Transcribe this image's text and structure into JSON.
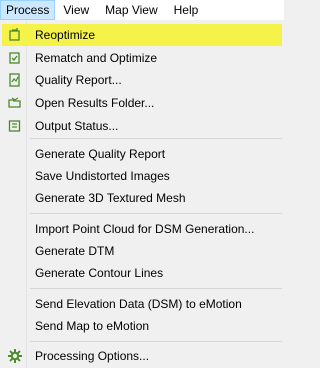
{
  "menubar": {
    "items": [
      "Process",
      "View",
      "Map View",
      "Help"
    ]
  },
  "menu": {
    "items": [
      {
        "label": "Reoptimize",
        "icon": "reoptimize-icon"
      },
      {
        "label": "Rematch and Optimize",
        "icon": "rematch-icon"
      },
      {
        "label": "Quality Report...",
        "icon": "quality-report-icon"
      },
      {
        "label": "Open Results Folder...",
        "icon": "folder-icon"
      },
      {
        "label": "Output Status...",
        "icon": "output-status-icon"
      },
      {
        "label": "Generate Quality Report"
      },
      {
        "label": "Save Undistorted Images"
      },
      {
        "label": "Generate 3D Textured Mesh"
      },
      {
        "label": "Import Point Cloud for DSM Generation..."
      },
      {
        "label": "Generate DTM"
      },
      {
        "label": "Generate Contour Lines"
      },
      {
        "label": "Send Elevation Data (DSM) to eMotion"
      },
      {
        "label": "Send Map to eMotion"
      },
      {
        "label": "Processing Options...",
        "icon": "gear-icon"
      }
    ]
  },
  "colors": {
    "highlight": "#f5f34a",
    "icon_green": "#4a8a2a",
    "menubar_active": "#cce8ff"
  }
}
